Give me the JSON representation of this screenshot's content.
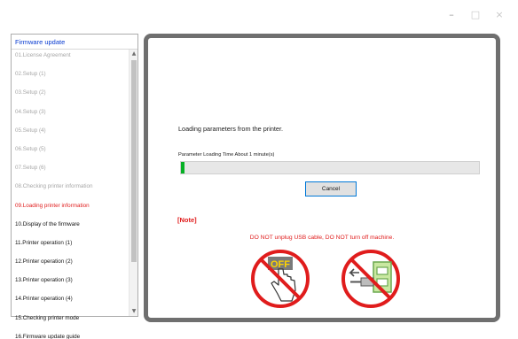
{
  "window": {
    "minimize_glyph": "–",
    "maximize_glyph": "□",
    "close_glyph": "×"
  },
  "sidebar": {
    "header": "Firmware update",
    "items": [
      {
        "label": "01.License Agreement",
        "state": "done"
      },
      {
        "label": "02.Setup (1)",
        "state": "done"
      },
      {
        "label": "03.Setup (2)",
        "state": "done"
      },
      {
        "label": "04.Setup (3)",
        "state": "done"
      },
      {
        "label": "05.Setup (4)",
        "state": "done"
      },
      {
        "label": "06.Setup (5)",
        "state": "done"
      },
      {
        "label": "07.Setup (6)",
        "state": "done"
      },
      {
        "label": "08.Checking printer information",
        "state": "done"
      },
      {
        "label": "09.Loading printer information",
        "state": "current"
      },
      {
        "label": "10.Display of the firmware",
        "state": "pending"
      },
      {
        "label": "11.Printer operation (1)",
        "state": "pending"
      },
      {
        "label": "12.Printer operation (2)",
        "state": "pending"
      },
      {
        "label": "13.Printer operation (3)",
        "state": "pending"
      },
      {
        "label": "14.Printer operation (4)",
        "state": "pending"
      },
      {
        "label": "15.Checking printer mode",
        "state": "pending"
      },
      {
        "label": "16.Firmware update guide",
        "state": "pending"
      }
    ],
    "scroll_up_glyph": "▲",
    "scroll_down_glyph": "▼"
  },
  "main": {
    "loading_title": "Loading parameters from the printer.",
    "loading_time": "Parameter Loading Time About 1 minute(s)",
    "progress_fraction": 0.012,
    "cancel_label": "Cancel",
    "note_label": "[Note]",
    "warning_text": "DO NOT unplug USB cable, DO NOT turn off machine.",
    "off_icon_text": "OFF"
  },
  "colors": {
    "accent_red": "#e01c1c",
    "header_blue": "#0a3cd1",
    "progress_green": "#06b025",
    "panel_border": "#6f6f6f"
  },
  "icons": [
    "minimize-icon",
    "maximize-icon",
    "close-icon",
    "no-power-off-icon",
    "no-unplug-usb-icon"
  ]
}
